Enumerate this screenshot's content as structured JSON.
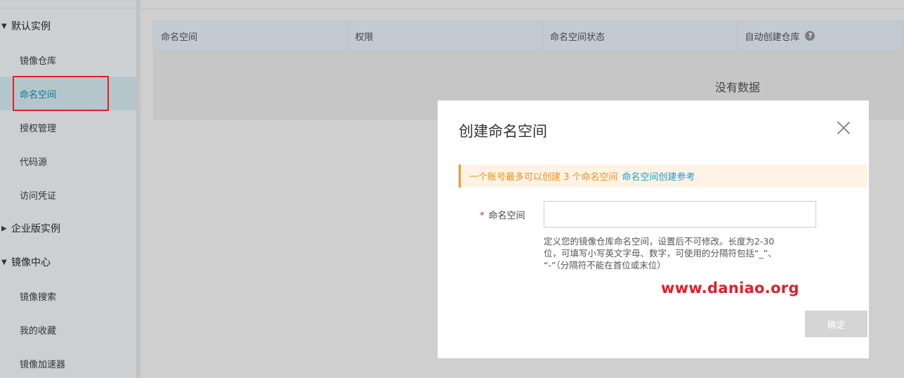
{
  "sidebar": {
    "groups": {
      "default_instance": {
        "label": "默认实例",
        "expanded": true
      },
      "enterprise_instance": {
        "label": "企业版实例",
        "expanded": false
      },
      "image_center": {
        "label": "镜像中心",
        "expanded": true
      }
    },
    "items": {
      "image_repo": "镜像仓库",
      "namespace": "命名空间",
      "auth_manage": "授权管理",
      "code_source": "代码源",
      "access_cred": "访问凭证",
      "image_search": "镜像搜索",
      "my_favorites": "我的收藏",
      "image_accel": "镜像加速器"
    },
    "active_item": "命名空间"
  },
  "table": {
    "columns": [
      "命名空间",
      "权限",
      "命名空间状态",
      "自动创建仓库"
    ],
    "help_icon": "?",
    "empty_text": "没有数据"
  },
  "modal": {
    "title": "创建命名空间",
    "notice": {
      "text": "一个账号最多可以创建 3 个命名空间",
      "link": "命名空间创建参考"
    },
    "field": {
      "required_mark": "*",
      "label": "命名空间",
      "value": "",
      "hint_lines": [
        "定义您的镜像仓库命名空间，设置后不可修改。长度为2-30",
        "位，可填写小写英文字母、数字，可使用的分隔符包括“_”、",
        "“-”（分隔符不能在首位或末位）"
      ]
    },
    "confirm_label": "确定"
  },
  "watermark": "www.daniao.org",
  "colors": {
    "accent": "#0a7a99",
    "notice_orange": "#f0901e",
    "link_blue": "#1d9bc8",
    "highlight_red": "#e0202a"
  },
  "icons": {
    "caret_down": "caret-down-icon",
    "caret_right": "caret-right-icon",
    "close": "close-icon",
    "help": "help-icon"
  }
}
